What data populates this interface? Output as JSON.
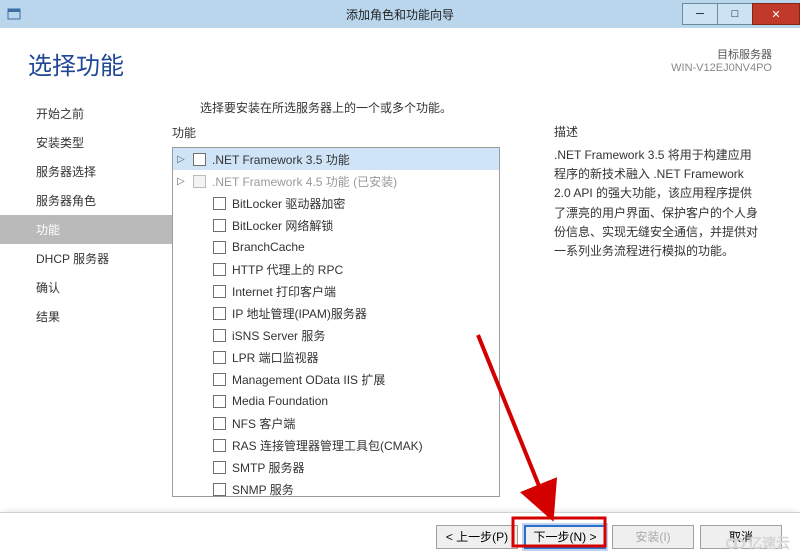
{
  "window": {
    "title": "添加角色和功能向导",
    "target_label": "目标服务器",
    "target_server": "WIN-V12EJ0NV4PO"
  },
  "page_title": "选择功能",
  "intro": "选择要安装在所选服务器上的一个或多个功能。",
  "labels": {
    "features": "功能",
    "description": "描述"
  },
  "sidebar": {
    "items": [
      {
        "label": "开始之前"
      },
      {
        "label": "安装类型"
      },
      {
        "label": "服务器选择"
      },
      {
        "label": "服务器角色"
      },
      {
        "label": "功能",
        "active": true
      },
      {
        "label": "DHCP 服务器"
      },
      {
        "label": "确认"
      },
      {
        "label": "结果"
      }
    ]
  },
  "features": [
    {
      "label": ".NET Framework 3.5 功能",
      "expandable": true,
      "selected": true,
      "indent": 0
    },
    {
      "label": ".NET Framework 4.5 功能 (已安装)",
      "expandable": true,
      "disabled": true,
      "indent": 0
    },
    {
      "label": "BitLocker 驱动器加密",
      "indent": 1
    },
    {
      "label": "BitLocker 网络解锁",
      "indent": 1
    },
    {
      "label": "BranchCache",
      "indent": 1
    },
    {
      "label": "HTTP 代理上的 RPC",
      "indent": 1
    },
    {
      "label": "Internet 打印客户端",
      "indent": 1
    },
    {
      "label": "IP 地址管理(IPAM)服务器",
      "indent": 1
    },
    {
      "label": "iSNS Server 服务",
      "indent": 1
    },
    {
      "label": "LPR 端口监视器",
      "indent": 1
    },
    {
      "label": "Management OData IIS 扩展",
      "indent": 1
    },
    {
      "label": "Media Foundation",
      "indent": 1
    },
    {
      "label": "NFS 客户端",
      "indent": 1
    },
    {
      "label": "RAS 连接管理器管理工具包(CMAK)",
      "indent": 1
    },
    {
      "label": "SMTP 服务器",
      "indent": 1
    },
    {
      "label": "SNMP 服务",
      "indent": 1
    }
  ],
  "description": ".NET Framework 3.5 将用于构建应用程序的新技术融入 .NET Framework 2.0 API 的强大功能，该应用程序提供了漂亮的用户界面、保护客户的个人身份信息、实现无缝安全通信，并提供对一系列业务流程进行模拟的功能。",
  "buttons": {
    "prev": "< 上一步(P)",
    "next": "下一步(N) >",
    "install": "安装(I)",
    "cancel": "取消"
  },
  "watermark": "亿速云"
}
